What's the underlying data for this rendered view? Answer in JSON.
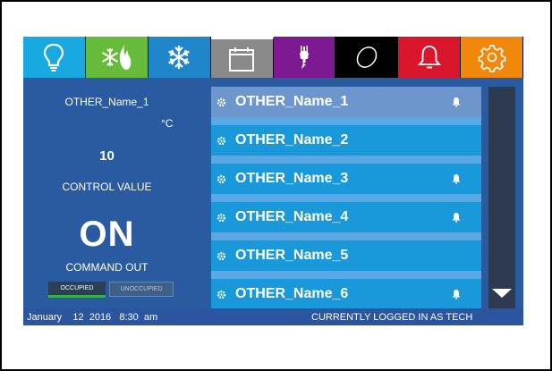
{
  "toolbar": {
    "icons": [
      "lightbulb-icon",
      "snowflake-flame-icon",
      "snowflake-icon",
      "calendar-icon",
      "plug-icon",
      "ring-icon",
      "bell-icon",
      "gear-icon"
    ]
  },
  "left_panel": {
    "point_name": "OTHER_Name_1",
    "unit": "°C",
    "control_value": "10",
    "control_value_label": "CONTROL VALUE",
    "command_state": "ON",
    "command_label": "COMMAND OUT",
    "occupied_button": "OCCUPIED",
    "unoccupied_button": "UNOCCUPIED"
  },
  "list": {
    "items": [
      {
        "label": "OTHER_Name_1",
        "has_alarm": true,
        "selected": true
      },
      {
        "label": "OTHER_Name_2",
        "has_alarm": false,
        "selected": false
      },
      {
        "label": "OTHER_Name_3",
        "has_alarm": true,
        "selected": false
      },
      {
        "label": "OTHER_Name_4",
        "has_alarm": true,
        "selected": false
      },
      {
        "label": "OTHER_Name_5",
        "has_alarm": false,
        "selected": false
      },
      {
        "label": "OTHER_Name_6",
        "has_alarm": true,
        "selected": false
      }
    ]
  },
  "status_bar": {
    "date": "January    12  2016   8:30  am",
    "login": "CURRENTLY LOGGED IN AS TECH"
  },
  "colors": {
    "panel_blue": "#2a5ba1",
    "row_blue": "#1999d9",
    "row_selected": "#6d97cc",
    "occupied_indicator": "#37b24a"
  }
}
